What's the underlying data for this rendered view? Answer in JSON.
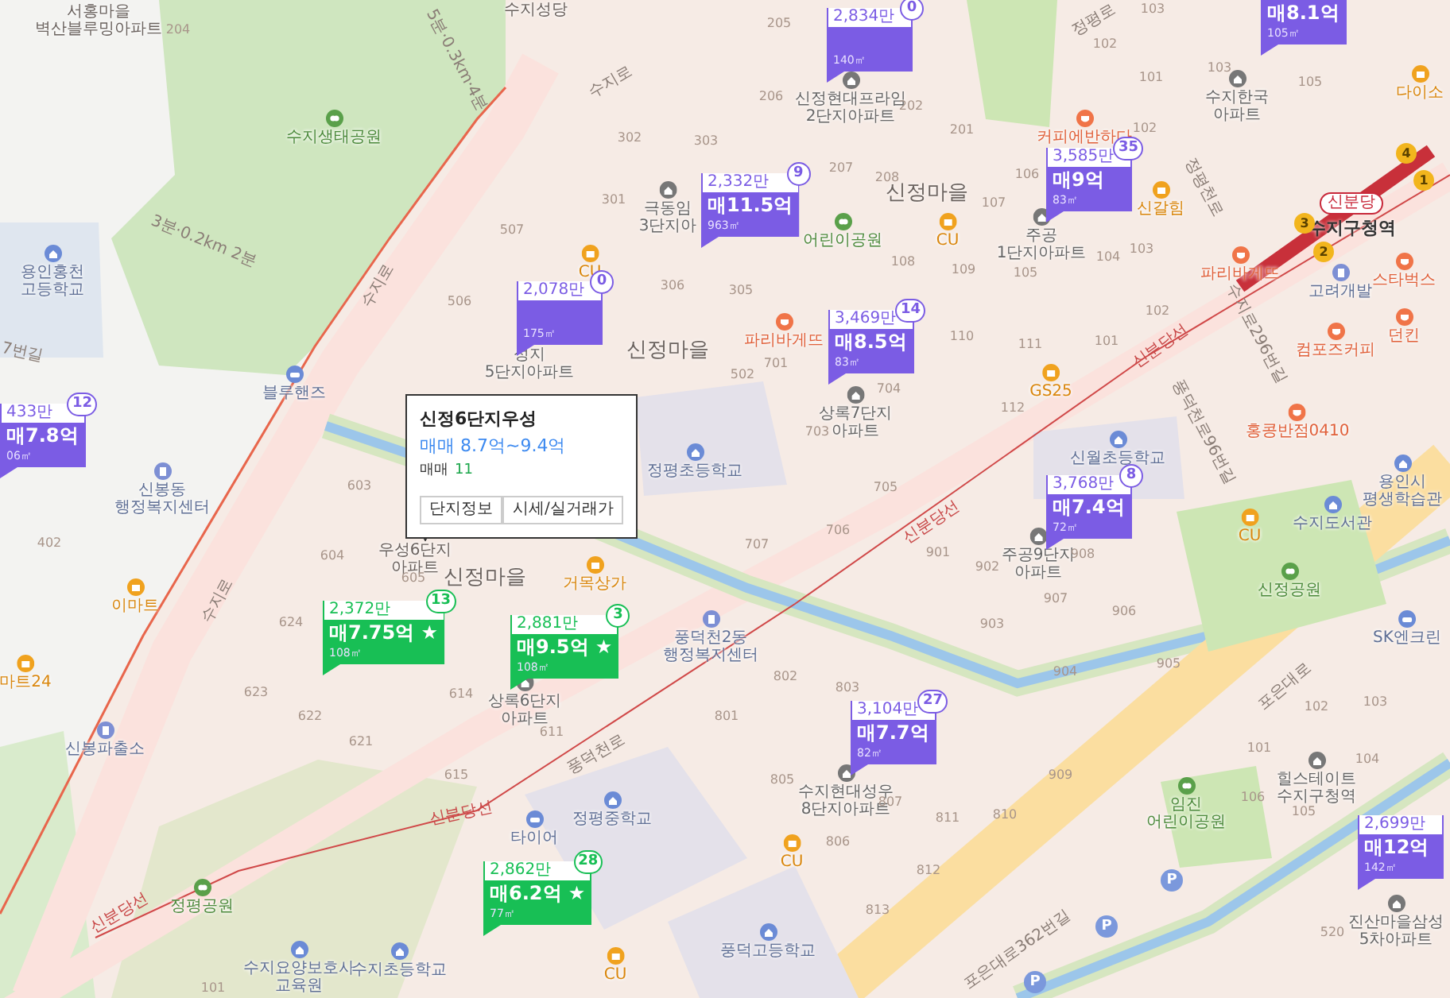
{
  "places": [
    {
      "lines": [
        "서홍마을",
        "벽산블루밍아파트"
      ],
      "kind": "label"
    },
    {
      "lines": [
        "수지생태공원"
      ],
      "kind": "park"
    },
    {
      "lines": [
        "용인홍천",
        "고등학교"
      ],
      "kind": "school"
    },
    {
      "lines": [
        "블루핸즈"
      ],
      "kind": "car"
    },
    {
      "lines": [
        "수지성당"
      ],
      "kind": "label"
    },
    {
      "lines": [
        "신정현대프라임",
        "2단지아파트"
      ],
      "kind": "apartment"
    },
    {
      "lines": [
        "수지한국",
        "아파트"
      ],
      "kind": "apartment"
    },
    {
      "lines": [
        "다이소"
      ],
      "kind": "store"
    },
    {
      "lines": [
        "극동임",
        "3단지아"
      ],
      "kind": "apartment"
    },
    {
      "lines": [
        "어린이공원"
      ],
      "kind": "park"
    },
    {
      "lines": [
        "커피에반하다"
      ],
      "kind": "food"
    },
    {
      "lines": [
        "CU"
      ],
      "kind": "store"
    },
    {
      "lines": [
        "CU"
      ],
      "kind": "store"
    },
    {
      "lines": [
        "성지",
        "5단지아파트"
      ],
      "kind": "apartment"
    },
    {
      "lines": [
        "파리바게뜨"
      ],
      "kind": "food"
    },
    {
      "lines": [
        "주공",
        "1단지아파트"
      ],
      "kind": "apartment"
    },
    {
      "lines": [
        "신갈힘"
      ],
      "kind": "store"
    },
    {
      "lines": [
        "파리바게뜨"
      ],
      "kind": "food"
    },
    {
      "lines": [
        "고려개발"
      ],
      "kind": "office"
    },
    {
      "lines": [
        "스타벅스"
      ],
      "kind": "food"
    },
    {
      "lines": [
        "던킨"
      ],
      "kind": "food"
    },
    {
      "lines": [
        "컴포즈커피"
      ],
      "kind": "food"
    },
    {
      "lines": [
        "GS25"
      ],
      "kind": "store"
    },
    {
      "lines": [
        "상록7단지",
        "아파트"
      ],
      "kind": "apartment"
    },
    {
      "lines": [
        "홍콩반점0410"
      ],
      "kind": "food"
    },
    {
      "lines": [
        "신월초등학교"
      ],
      "kind": "school"
    },
    {
      "lines": [
        "정평초등학교"
      ],
      "kind": "school"
    },
    {
      "lines": [
        "신봉동",
        "행정복지센터"
      ],
      "kind": "office"
    },
    {
      "lines": [
        "이마트"
      ],
      "kind": "store"
    },
    {
      "lines": [
        "마트24"
      ],
      "kind": "store"
    },
    {
      "lines": [
        "우성6단지",
        "아파트"
      ],
      "kind": "label"
    },
    {
      "lines": [
        "거목상가"
      ],
      "kind": "store"
    },
    {
      "lines": [
        "풍덕천2동",
        "행정복지센터"
      ],
      "kind": "office"
    },
    {
      "lines": [
        "상록6단지",
        "아파트"
      ],
      "kind": "apartment"
    },
    {
      "lines": [
        "신봉파출소"
      ],
      "kind": "office"
    },
    {
      "lines": [
        "수지현대성우",
        "8단지아파트"
      ],
      "kind": "apartment"
    },
    {
      "lines": [
        "정평중학교"
      ],
      "kind": "school"
    },
    {
      "lines": [
        "타이어"
      ],
      "kind": "car"
    },
    {
      "lines": [
        "CU"
      ],
      "kind": "store"
    },
    {
      "lines": [
        "정평공원"
      ],
      "kind": "park"
    },
    {
      "lines": [
        "수지요양보호사",
        "교육원"
      ],
      "kind": "school"
    },
    {
      "lines": [
        "수지초등학교"
      ],
      "kind": "school"
    },
    {
      "lines": [
        "CU"
      ],
      "kind": "store"
    },
    {
      "lines": [
        "풍덕고등학교"
      ],
      "kind": "school"
    },
    {
      "lines": [
        "용인시",
        "평생학습관"
      ],
      "kind": "school"
    },
    {
      "lines": [
        "수지도서관"
      ],
      "kind": "school"
    },
    {
      "lines": [
        "CU"
      ],
      "kind": "store"
    },
    {
      "lines": [
        "주공9단지",
        "아파트"
      ],
      "kind": "apartment"
    },
    {
      "lines": [
        "신정공원"
      ],
      "kind": "park"
    },
    {
      "lines": [
        "SK엔크린"
      ],
      "kind": "car"
    },
    {
      "lines": [
        "힐스테이트",
        "수지구청역"
      ],
      "kind": "apartment"
    },
    {
      "lines": [
        "임진",
        "어린이공원"
      ],
      "kind": "park"
    },
    {
      "lines": [
        "진산마을삼성",
        "5차아파트"
      ],
      "kind": "apartment"
    },
    {
      "lines": [
        "P"
      ],
      "kind": "parking"
    },
    {
      "lines": [
        "P"
      ],
      "kind": "parking"
    },
    {
      "lines": [
        "P"
      ],
      "kind": "parking"
    }
  ],
  "districts": [
    "신정마을",
    "신정마을",
    "신정마을"
  ],
  "lot_numbers": [
    "204",
    "506",
    "603",
    "205",
    "206",
    "302",
    "303",
    "301",
    "507",
    "207",
    "208",
    "202",
    "201",
    "306",
    "305",
    "502",
    "701",
    "703",
    "704",
    "705",
    "108",
    "109",
    "110",
    "103",
    "102",
    "101",
    "103",
    "105",
    "102",
    "106",
    "107",
    "104",
    "105",
    "103",
    "102",
    "111",
    "101",
    "112",
    "402",
    "604",
    "605",
    "624",
    "623",
    "622",
    "621",
    "614",
    "615",
    "101",
    "611",
    "707",
    "706",
    "901",
    "802",
    "803",
    "801",
    "805",
    "806",
    "807",
    "811",
    "812",
    "813",
    "902",
    "908",
    "907",
    "906",
    "903",
    "905",
    "904",
    "909",
    "810",
    "102",
    "103",
    "101",
    "104",
    "106",
    "105",
    "520"
  ],
  "road_labels": [
    "수지로",
    "수지로",
    "수지로",
    "정평로",
    "정평천로",
    "수지로296번길",
    "풍덕천로96번길",
    "신분당선",
    "신분당선",
    "신분당선",
    "신분당선",
    "풍덕천로",
    "포은대로",
    "포은대로362번길",
    "7번길",
    "3분·0.2km 2분",
    "5분·0.3km·4분"
  ],
  "subway": {
    "line_badge": "신분당",
    "station": "수지구청역",
    "exits": [
      "1",
      "2",
      "3",
      "4"
    ]
  },
  "markers": [
    {
      "price_per": "2,834만",
      "count": "0",
      "area": "140㎡",
      "color": "#7b5ce4"
    },
    {
      "price": "매8.1억",
      "area": "105㎡",
      "color": "#7b5ce4"
    },
    {
      "price_per": "3,585만",
      "count": "35",
      "price": "매9억",
      "area": "83㎡",
      "color": "#7b5ce4"
    },
    {
      "price_per": "2,332만",
      "count": "9",
      "price": "매11.5억",
      "area": "963㎡",
      "color": "#7b5ce4"
    },
    {
      "price_per": "2,078만",
      "count": "0",
      "area": "175㎡",
      "color": "#7b5ce4"
    },
    {
      "price_per": "3,469만",
      "count": "14",
      "price": "매8.5억",
      "area": "83㎡",
      "color": "#7b5ce4"
    },
    {
      "price_per": "433만",
      "count": "12",
      "price": "매7.8억",
      "area": "06㎡",
      "color": "#7b5ce4"
    },
    {
      "price_per": "3,768만",
      "count": "8",
      "price": "매7.4억",
      "area": "72㎡",
      "color": "#7b5ce4"
    },
    {
      "price_per": "2,372만",
      "count": "13",
      "price": "매7.75억 ★",
      "area": "108㎡",
      "color": "#18bf55"
    },
    {
      "price_per": "2,881만",
      "count": "3",
      "price": "매9.5억 ★",
      "area": "108㎡",
      "color": "#18bf55"
    },
    {
      "price_per": "3,104만",
      "count": "27",
      "price": "매7.7억",
      "area": "82㎡",
      "color": "#7b5ce4"
    },
    {
      "price_per": "2,699만",
      "price": "매12억",
      "area": "142㎡",
      "color": "#7b5ce4"
    },
    {
      "price_per": "2,862만",
      "count": "28",
      "price": "매6.2억 ★",
      "area": "77㎡",
      "color": "#18bf55"
    }
  ],
  "popup": {
    "title": "신정6단지우성",
    "price_range": "매매 8.7억~9.4억",
    "listing_label": "매매",
    "listing_count": "11",
    "buttons": [
      "단지정보",
      "시세/실거래가"
    ]
  }
}
